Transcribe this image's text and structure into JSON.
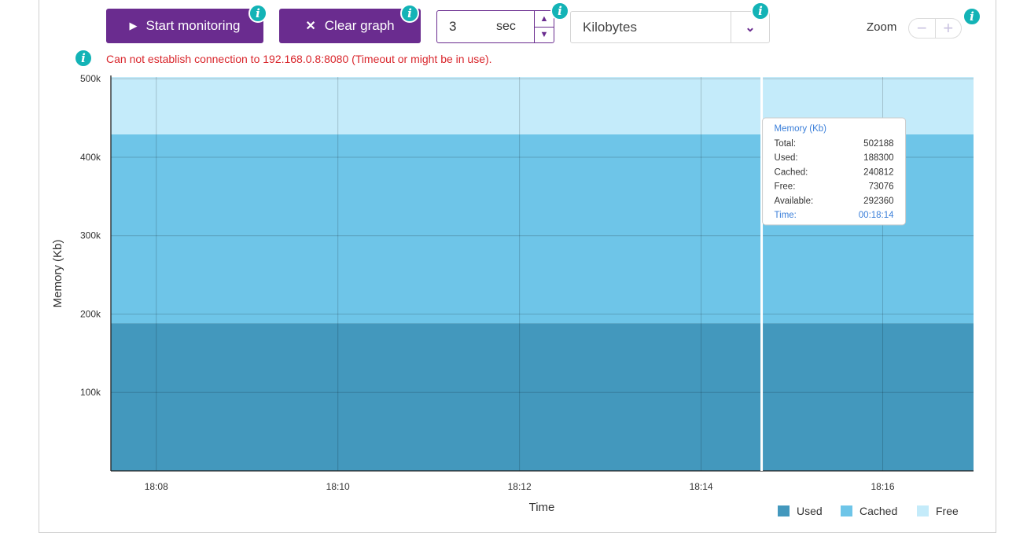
{
  "controls": {
    "start_label": "Start monitoring",
    "clear_label": "Clear graph",
    "interval_value": "3",
    "interval_unit": "sec",
    "unit_select": "Kilobytes",
    "zoom_label": "Zoom",
    "zoom_out": "−",
    "zoom_in": "+",
    "info_glyph": "i",
    "error_text": "Can not establish connection to 192.168.0.8:8080 (Timeout or might be in use)."
  },
  "colors": {
    "used": "#4398bd",
    "cached": "#6ec5e8",
    "free": "#c4ebfa",
    "accent": "#6a2c8f",
    "info": "#13b3b6",
    "error": "#d9262c"
  },
  "chart_data": {
    "type": "area",
    "stacked": true,
    "xlabel": "Time",
    "ylabel": "Memory (Kb)",
    "x_ticks": [
      "18:08",
      "18:10",
      "18:12",
      "18:14",
      "18:16"
    ],
    "y_ticks": [
      "500k",
      "400k",
      "300k",
      "200k",
      "100k"
    ],
    "ylim": [
      0,
      502188
    ],
    "x": [
      "18:07:30",
      "18:17:00"
    ],
    "series": [
      {
        "name": "Used",
        "values": [
          188300,
          188300
        ]
      },
      {
        "name": "Cached",
        "values": [
          240812,
          240812
        ]
      },
      {
        "name": "Free",
        "values": [
          73076,
          73076
        ]
      }
    ],
    "legend": [
      "Used",
      "Cached",
      "Free"
    ],
    "legend_position": "bottom-right",
    "grid": true,
    "tooltip": {
      "title": "Memory (Kb)",
      "rows": [
        {
          "label": "Total:",
          "value": "502188"
        },
        {
          "label": "Used:",
          "value": "188300"
        },
        {
          "label": "Cached:",
          "value": "240812"
        },
        {
          "label": "Free:",
          "value": "73076"
        },
        {
          "label": "Available:",
          "value": "292360"
        }
      ],
      "time_label": "Time:",
      "time_value": "00:18:14",
      "cursor_time": "18:14:40"
    }
  }
}
